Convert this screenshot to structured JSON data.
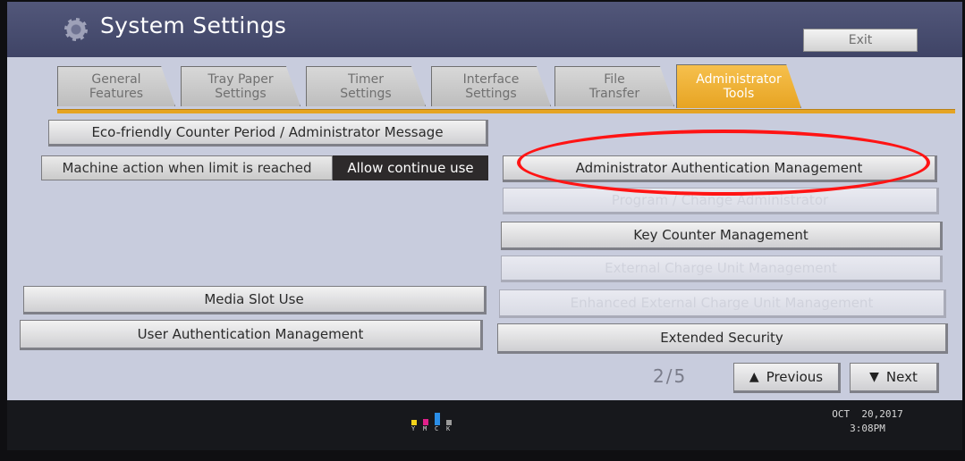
{
  "header": {
    "title": "System Settings",
    "exit_label": "Exit"
  },
  "tabs": [
    {
      "label": "General\nFeatures",
      "active": false
    },
    {
      "label": "Tray Paper\nSettings",
      "active": false
    },
    {
      "label": "Timer\nSettings",
      "active": false
    },
    {
      "label": "Interface\nSettings",
      "active": false
    },
    {
      "label": "File\nTransfer",
      "active": false
    },
    {
      "label": "Administrator\nTools",
      "active": true
    }
  ],
  "left": {
    "eco_button": "Eco-friendly Counter Period / Administrator Message",
    "limit_label": "Machine action when limit is reached",
    "limit_value": "Allow continue use",
    "media_slot_button": "Media Slot Use",
    "user_auth_button": "User Authentication Management"
  },
  "right": {
    "admin_auth_button": "Administrator Authentication Management",
    "program_admin_button": "Program / Change Administrator",
    "key_counter_button": "Key Counter Management",
    "external_charge_button": "External Charge Unit Management",
    "enhanced_external_button": "Enhanced External Charge Unit Management",
    "extended_security_button": "Extended Security"
  },
  "pagination": {
    "page_text": "2/5",
    "previous_label": "Previous",
    "next_label": "Next"
  },
  "footer": {
    "toner_labels": [
      "Y",
      "M",
      "C",
      "K"
    ],
    "date": "OCT  20,2017",
    "time": "3:08PM"
  },
  "colors": {
    "active_tab": "#e7a423",
    "highlight": "#ff1414",
    "panel": "#c8ccdd"
  }
}
